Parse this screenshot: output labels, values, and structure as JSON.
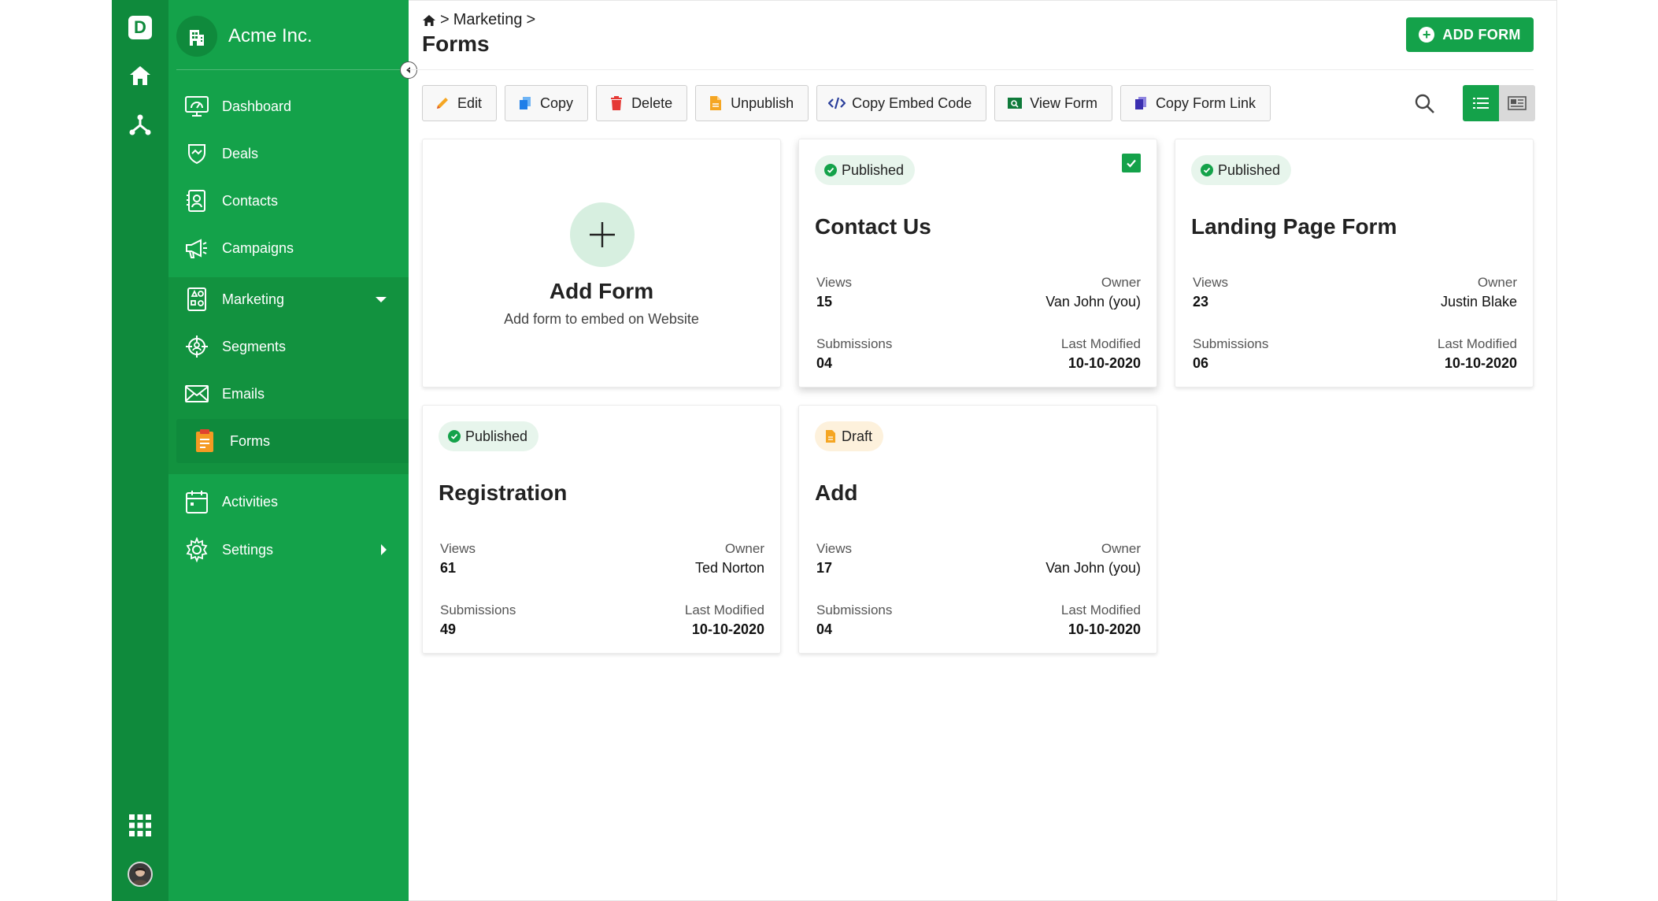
{
  "rail": {
    "logo_letter": "D",
    "icons": [
      "home-icon",
      "network-icon",
      "apps-grid-icon",
      "avatar"
    ]
  },
  "sidebar": {
    "org_name": "Acme Inc.",
    "items": [
      {
        "label": "Dashboard",
        "icon": "dashboard-icon"
      },
      {
        "label": "Deals",
        "icon": "handshake-icon"
      },
      {
        "label": "Contacts",
        "icon": "contact-icon"
      },
      {
        "label": "Campaigns",
        "icon": "megaphone-icon"
      },
      {
        "label": "Marketing",
        "icon": "marketing-icon"
      },
      {
        "label": "Segments",
        "icon": "segments-icon"
      },
      {
        "label": "Emails",
        "icon": "email-icon"
      },
      {
        "label": "Forms",
        "icon": "forms-icon"
      },
      {
        "label": "Activities",
        "icon": "calendar-icon"
      },
      {
        "label": "Settings",
        "icon": "gear-icon"
      }
    ]
  },
  "header": {
    "breadcrumb": [
      "Marketing"
    ],
    "title": "Forms",
    "add_button": "ADD FORM"
  },
  "toolbar": {
    "buttons": [
      {
        "label": "Edit",
        "icon": "pencil-icon"
      },
      {
        "label": "Copy",
        "icon": "copy-icon"
      },
      {
        "label": "Delete",
        "icon": "trash-icon"
      },
      {
        "label": "Unpublish",
        "icon": "document-icon"
      },
      {
        "label": "Copy Embed Code",
        "icon": "code-icon"
      },
      {
        "label": "View Form",
        "icon": "view-icon"
      },
      {
        "label": "Copy Form Link",
        "icon": "link-copy-icon"
      }
    ]
  },
  "add_card": {
    "title": "Add Form",
    "subtitle": "Add form to embed on Website"
  },
  "labels": {
    "views": "Views",
    "owner": "Owner",
    "submissions": "Submissions",
    "last_modified": "Last Modified"
  },
  "cards": [
    {
      "status": "Published",
      "title": "Contact Us",
      "views": "15",
      "owner": "Van John (you)",
      "submissions": "04",
      "last_modified": "10-10-2020",
      "selected": true
    },
    {
      "status": "Published",
      "title": "Landing Page Form",
      "views": "23",
      "owner": "Justin Blake",
      "submissions": "06",
      "last_modified": "10-10-2020",
      "selected": false
    },
    {
      "status": "Published",
      "title": "Registration",
      "views": "61",
      "owner": "Ted Norton",
      "submissions": "49",
      "last_modified": "10-10-2020",
      "selected": false
    },
    {
      "status": "Draft",
      "title": "Add",
      "views": "17",
      "owner": "Van John (you)",
      "submissions": "04",
      "last_modified": "10-10-2020",
      "selected": false
    }
  ],
  "colors": {
    "brand_green": "#14a24a",
    "rail_green": "#0f8a3c",
    "published_bg": "#e7f5ec",
    "draft_bg": "#fdf1dc"
  }
}
